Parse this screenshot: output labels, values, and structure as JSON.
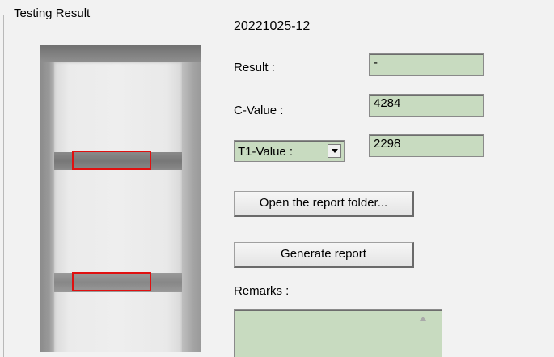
{
  "group": {
    "title": "Testing Result"
  },
  "sample_id": "20221025-12",
  "result": {
    "label": "Result :",
    "value": "-"
  },
  "c_value": {
    "label": "C-Value :",
    "value": "4284"
  },
  "t_value": {
    "selected": "T1-Value :",
    "value": "2298"
  },
  "buttons": {
    "open_folder": "Open the report folder...",
    "generate": "Generate report"
  },
  "remarks": {
    "label": "Remarks :",
    "value": ""
  },
  "colors": {
    "field_bg": "#c8dbc0",
    "roi_box": "#e01010",
    "window_bg": "#f2f2f2"
  },
  "icons": {
    "dropdown": "chevron-down-icon",
    "scroll": "scroll-up-arrow-icon"
  }
}
